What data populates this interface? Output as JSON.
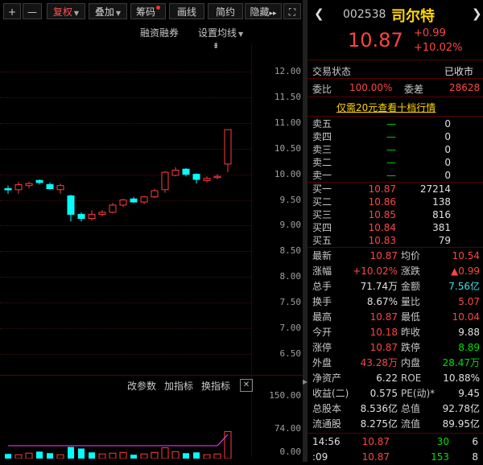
{
  "toolbar": {
    "plus": "+",
    "minus": "—",
    "fuquan": "复权",
    "diejia": "叠加",
    "chouma": "筹码",
    "huaxian": "画线",
    "jianyue": "简约",
    "yincang": "隐藏",
    "more": "▸▸",
    "expand": "⛶"
  },
  "chart_head": {
    "rzrq": "融资融券",
    "set_ma": "设置均线",
    "pin": "⇟"
  },
  "chart_data": {
    "type": "candlestick",
    "ylim": [
      6.2,
      12.2
    ],
    "y_ticks": [
      "12.00",
      "11.50",
      "11.00",
      "10.50",
      "10.00",
      "9.50",
      "9.00",
      "8.50",
      "8.00",
      "7.50",
      "7.00",
      "6.50"
    ],
    "candles": [
      {
        "o": 9.72,
        "c": 9.7,
        "h": 9.78,
        "l": 9.62
      },
      {
        "o": 9.7,
        "c": 9.8,
        "h": 9.85,
        "l": 9.62
      },
      {
        "o": 9.78,
        "c": 9.82,
        "h": 9.86,
        "l": 9.72
      },
      {
        "o": 9.88,
        "c": 9.84,
        "h": 9.9,
        "l": 9.8
      },
      {
        "o": 9.8,
        "c": 9.72,
        "h": 9.84,
        "l": 9.7
      },
      {
        "o": 9.7,
        "c": 9.78,
        "h": 9.82,
        "l": 9.62
      },
      {
        "o": 9.58,
        "c": 9.22,
        "h": 9.6,
        "l": 9.08
      },
      {
        "o": 9.22,
        "c": 9.14,
        "h": 9.26,
        "l": 9.08
      },
      {
        "o": 9.14,
        "c": 9.22,
        "h": 9.3,
        "l": 9.1
      },
      {
        "o": 9.22,
        "c": 9.26,
        "h": 9.3,
        "l": 9.18
      },
      {
        "o": 9.26,
        "c": 9.4,
        "h": 9.44,
        "l": 9.24
      },
      {
        "o": 9.4,
        "c": 9.5,
        "h": 9.52,
        "l": 9.36
      },
      {
        "o": 9.52,
        "c": 9.46,
        "h": 9.56,
        "l": 9.44
      },
      {
        "o": 9.46,
        "c": 9.56,
        "h": 9.58,
        "l": 9.42
      },
      {
        "o": 9.56,
        "c": 9.68,
        "h": 9.72,
        "l": 9.54
      },
      {
        "o": 9.7,
        "c": 10.04,
        "h": 10.06,
        "l": 9.64
      },
      {
        "o": 9.98,
        "c": 10.08,
        "h": 10.14,
        "l": 9.96
      },
      {
        "o": 10.1,
        "c": 10.0,
        "h": 10.12,
        "l": 9.96
      },
      {
        "o": 10.0,
        "c": 9.9,
        "h": 10.02,
        "l": 9.82
      },
      {
        "o": 9.88,
        "c": 9.92,
        "h": 9.96,
        "l": 9.84
      },
      {
        "o": 9.94,
        "c": 9.96,
        "h": 10.0,
        "l": 9.9
      },
      {
        "o": 10.2,
        "c": 10.87,
        "h": 10.87,
        "l": 10.04
      }
    ],
    "vol_ticks": [
      "150.00",
      "74.00",
      "0.00"
    ],
    "volumes": [
      {
        "v": 12,
        "up": false
      },
      {
        "v": 10,
        "up": true
      },
      {
        "v": 14,
        "up": true
      },
      {
        "v": 18,
        "up": false
      },
      {
        "v": 14,
        "up": false
      },
      {
        "v": 10,
        "up": true
      },
      {
        "v": 30,
        "up": false
      },
      {
        "v": 26,
        "up": false
      },
      {
        "v": 16,
        "up": false
      },
      {
        "v": 12,
        "up": true
      },
      {
        "v": 14,
        "up": true
      },
      {
        "v": 16,
        "up": true
      },
      {
        "v": 10,
        "up": false
      },
      {
        "v": 12,
        "up": true
      },
      {
        "v": 16,
        "up": true
      },
      {
        "v": 28,
        "up": true
      },
      {
        "v": 18,
        "up": true
      },
      {
        "v": 14,
        "up": false
      },
      {
        "v": 16,
        "up": false
      },
      {
        "v": 10,
        "up": true
      },
      {
        "v": 12,
        "up": true
      },
      {
        "v": 70,
        "up": true
      }
    ]
  },
  "sub_chart": {
    "gai_canshu": "改参数",
    "jia_zhibiao": "加指标",
    "huan_zhibiao": "换指标",
    "close": "✕"
  },
  "stock": {
    "code": "002538",
    "name": "司尔特",
    "price": "10.87",
    "chg": "+0.99",
    "pct": "+10.02%",
    "status_label": "交易状态",
    "status_value": "已收市",
    "wb_label": "委比",
    "wb_value": "100.00%",
    "wc_label": "委差",
    "wc_value": "28628",
    "promo": "仅需20元查看十档行情"
  },
  "sell": [
    {
      "name": "卖五",
      "price": "—",
      "vol": "0"
    },
    {
      "name": "卖四",
      "price": "—",
      "vol": "0"
    },
    {
      "name": "卖三",
      "price": "—",
      "vol": "0"
    },
    {
      "name": "卖二",
      "price": "—",
      "vol": "0"
    },
    {
      "name": "卖一",
      "price": "—",
      "vol": "0"
    }
  ],
  "buy": [
    {
      "name": "买一",
      "price": "10.87",
      "vol": "27214"
    },
    {
      "name": "买二",
      "price": "10.86",
      "vol": "138"
    },
    {
      "name": "买三",
      "price": "10.85",
      "vol": "816"
    },
    {
      "name": "买四",
      "price": "10.84",
      "vol": "381"
    },
    {
      "name": "买五",
      "price": "10.83",
      "vol": "79"
    }
  ],
  "stats": [
    {
      "l1": "最新",
      "v1": "10.87",
      "c1": "red",
      "l2": "均价",
      "v2": "10.54",
      "c2": "red"
    },
    {
      "l1": "涨幅",
      "v1": "+10.02%",
      "c1": "red",
      "l2": "涨跌",
      "v2": "▲0.99",
      "c2": "red"
    },
    {
      "l1": "总手",
      "v1": "71.74万",
      "c1": "white",
      "l2": "金额",
      "v2": "7.56亿",
      "c2": "cyan"
    },
    {
      "l1": "换手",
      "v1": "8.67%",
      "c1": "white",
      "l2": "量比",
      "v2": "5.07",
      "c2": "red"
    },
    {
      "l1": "最高",
      "v1": "10.87",
      "c1": "red",
      "l2": "最低",
      "v2": "10.04",
      "c2": "red"
    },
    {
      "l1": "今开",
      "v1": "10.18",
      "c1": "red",
      "l2": "昨收",
      "v2": "9.88",
      "c2": "white"
    },
    {
      "l1": "涨停",
      "v1": "10.87",
      "c1": "red",
      "l2": "跌停",
      "v2": "8.89",
      "c2": "green"
    },
    {
      "l1": "外盘",
      "v1": "43.28万",
      "c1": "red",
      "l2": "内盘",
      "v2": "28.47万",
      "c2": "green"
    },
    {
      "l1": "净资产",
      "v1": "6.22",
      "c1": "white",
      "l2": "ROE",
      "v2": "10.88%",
      "c2": "white"
    },
    {
      "l1": "收益(二)",
      "v1": "0.575",
      "c1": "white",
      "l2": "PE(动)*",
      "v2": "9.45",
      "c2": "white"
    },
    {
      "l1": "总股本",
      "v1": "8.536亿",
      "c1": "white",
      "l2": "总值",
      "v2": "92.78亿",
      "c2": "white"
    },
    {
      "l1": "流通股",
      "v1": "8.275亿",
      "c1": "white",
      "l2": "流值",
      "v2": "89.95亿",
      "c2": "white"
    }
  ],
  "ticks": [
    {
      "time": "14:56",
      "price": "10.87",
      "vol": "30",
      "n": "6"
    },
    {
      "time": ":09",
      "price": "10.87",
      "vol": "153",
      "n": "8"
    }
  ],
  "colors": {
    "up": "#ff3c3c",
    "down": "#00ffff",
    "bg": "#000000"
  }
}
